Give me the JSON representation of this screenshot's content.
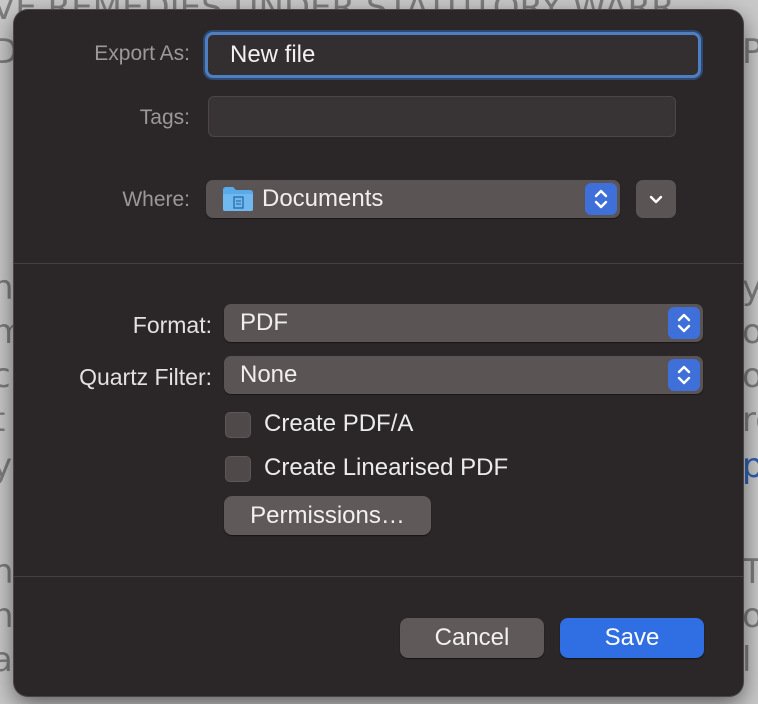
{
  "background_document": {
    "lines": [
      "VE REMEDIES UNDER STATUTORY WARR",
      "D",
      "h",
      "m",
      "c",
      "t",
      "y",
      "h",
      "n",
      "a"
    ],
    "right_fragments": [
      "P",
      "y",
      "o",
      "o",
      "re",
      "p",
      "T",
      "o",
      "l"
    ]
  },
  "dialog": {
    "export_as_label": "Export As:",
    "export_as_value": "New file",
    "tags_label": "Tags:",
    "tags_value": "",
    "where_label": "Where:",
    "where_value": "Documents",
    "where_icon": "folder-icon",
    "format_label": "Format:",
    "format_value": "PDF",
    "quartz_label": "Quartz Filter:",
    "quartz_value": "None",
    "checkbox_pdfa": "Create PDF/A",
    "checkbox_linearised": "Create Linearised PDF",
    "permissions_button": "Permissions…",
    "cancel_button": "Cancel",
    "save_button": "Save"
  },
  "colors": {
    "accent": "#2f6ee3",
    "sheet_bg": "#2b2627",
    "focus_ring": "#4f7fc0"
  }
}
